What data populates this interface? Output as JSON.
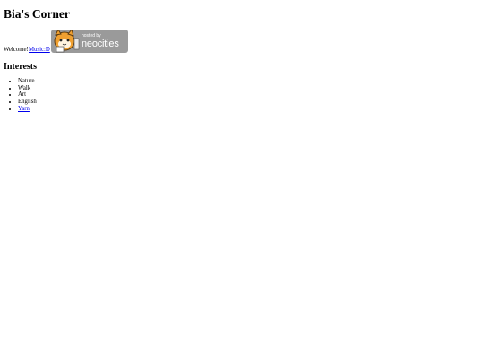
{
  "site": {
    "title": "Bia's Corner"
  },
  "welcome": {
    "text": "Welcome!",
    "music_link": "Music:D"
  },
  "badge": {
    "small_text": "hosted by",
    "big_text": "neocities",
    "icon": "neocities-cat-icon"
  },
  "interests": {
    "heading": "Interests",
    "items": [
      {
        "label": "Nature",
        "link": false
      },
      {
        "label": "Walk",
        "link": false
      },
      {
        "label": "Art",
        "link": false
      },
      {
        "label": "English",
        "link": false
      },
      {
        "label": "Yarn",
        "link": true
      }
    ]
  },
  "colors": {
    "link": "#0000ee",
    "badge_bg": "#9a9a9a",
    "cat_orange": "#f0a030"
  }
}
